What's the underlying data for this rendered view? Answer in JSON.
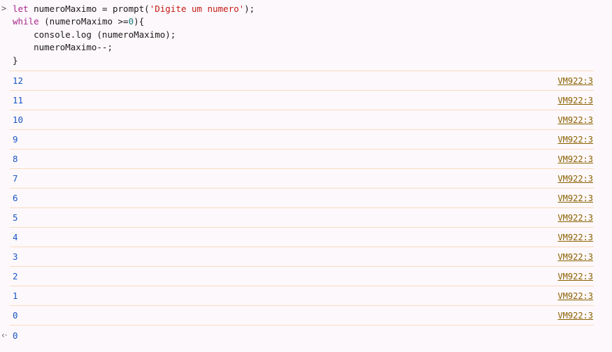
{
  "console": {
    "prompt_symbol": ">",
    "return_symbol": "‹·",
    "input": {
      "lines": [
        [
          {
            "t": "let ",
            "c": "kw2"
          },
          {
            "t": "numeroMaximo = ",
            "c": "pl"
          },
          {
            "t": "prompt(",
            "c": "pl"
          },
          {
            "t": "'Digite um numero'",
            "c": "str"
          },
          {
            "t": ");",
            "c": "pl"
          }
        ],
        [
          {
            "t": "while ",
            "c": "kw2"
          },
          {
            "t": "(numeroMaximo >=",
            "c": "pl"
          },
          {
            "t": "0",
            "c": "num"
          },
          {
            "t": "){",
            "c": "pl"
          }
        ],
        [
          {
            "t": "    console.log (numeroMaximo);",
            "c": "pl"
          }
        ],
        [
          {
            "t": "    numeroMaximo--;",
            "c": "pl"
          }
        ],
        [
          {
            "t": "}",
            "c": "pl"
          }
        ]
      ]
    },
    "output_rows": [
      {
        "value": "12",
        "source": "VM922:3"
      },
      {
        "value": "11",
        "source": "VM922:3"
      },
      {
        "value": "10",
        "source": "VM922:3"
      },
      {
        "value": "9",
        "source": "VM922:3"
      },
      {
        "value": "8",
        "source": "VM922:3"
      },
      {
        "value": "7",
        "source": "VM922:3"
      },
      {
        "value": "6",
        "source": "VM922:3"
      },
      {
        "value": "5",
        "source": "VM922:3"
      },
      {
        "value": "4",
        "source": "VM922:3"
      },
      {
        "value": "3",
        "source": "VM922:3"
      },
      {
        "value": "2",
        "source": "VM922:3"
      },
      {
        "value": "1",
        "source": "VM922:3"
      },
      {
        "value": "0",
        "source": "VM922:3"
      }
    ],
    "return_value": "0",
    "colors": {
      "background": "#fdf8fb",
      "separator": "#f8ddc0",
      "output_number": "#1a56c4",
      "source_link": "#8a6100",
      "keyword": "#a8288f",
      "string": "#c41a16",
      "number_literal": "#1c7d7d",
      "plain_code": "#1a1a1a",
      "gutter": "#5f6368"
    }
  }
}
